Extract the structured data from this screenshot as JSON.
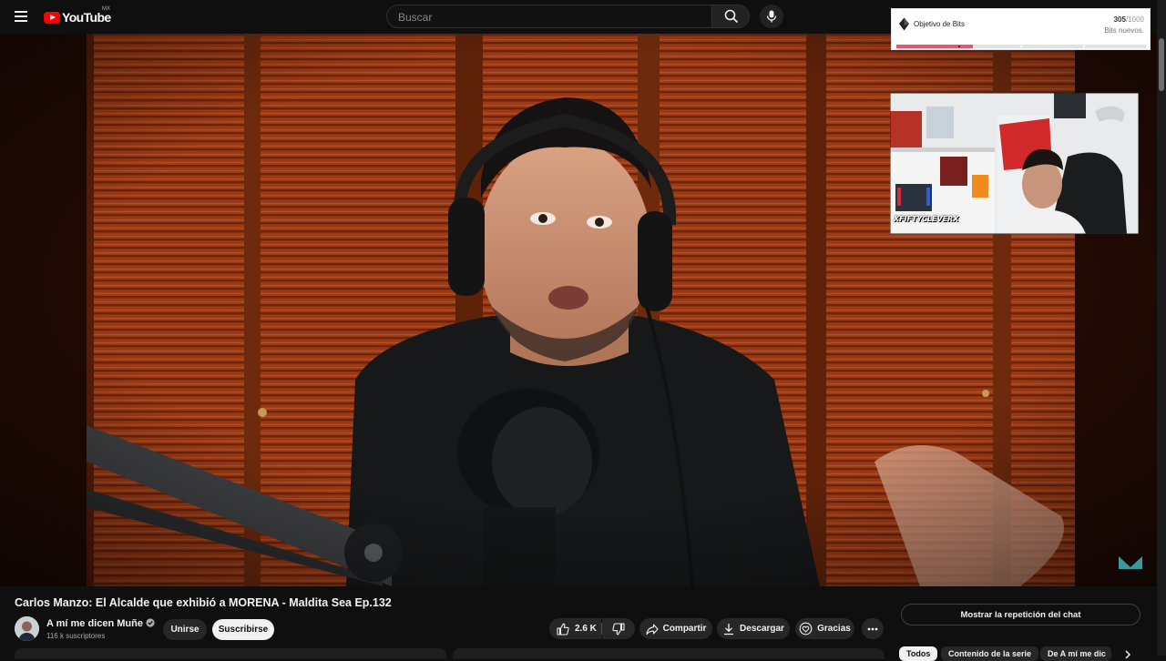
{
  "header": {
    "logo_text": "YouTube",
    "logo_region": "MX",
    "search": {
      "placeholder": "Buscar",
      "value": ""
    }
  },
  "video": {
    "overlay": {
      "bits_goal": {
        "label": "Objetivo de Bits",
        "current": "305",
        "total": "/1000",
        "subtitle": "Bits nuevos.",
        "progress_fraction": 0.305
      },
      "webcam_tag": "XFIFTYCLEVERX"
    },
    "title": "Carlos Manzo: El Alcalde que exhibió a MORENA - Maldita Sea Ep.132"
  },
  "channel": {
    "name": "A mí me dicen Muñe",
    "subscribers": "116 k suscriptores",
    "join_label": "Unirse",
    "subscribe_label": "Suscribirse"
  },
  "actions": {
    "likes": "2.6 K",
    "share": "Compartir",
    "download": "Descargar",
    "thanks": "Gracias"
  },
  "chat": {
    "replay_label": "Mostrar la repetición del chat"
  },
  "chips": [
    "Todos",
    "Contenido de la serie",
    "De A mí me dic"
  ],
  "colors": {
    "accent": "#ff0000",
    "bits_fill": "#e3586a",
    "background": "#0f0f0f"
  },
  "icons": [
    "menu-icon",
    "search-icon",
    "mic-icon",
    "like-icon",
    "dislike-icon",
    "share-icon",
    "download-icon",
    "thanks-icon",
    "more-icon",
    "verified-icon",
    "chevron-right-icon",
    "diamond-icon"
  ]
}
